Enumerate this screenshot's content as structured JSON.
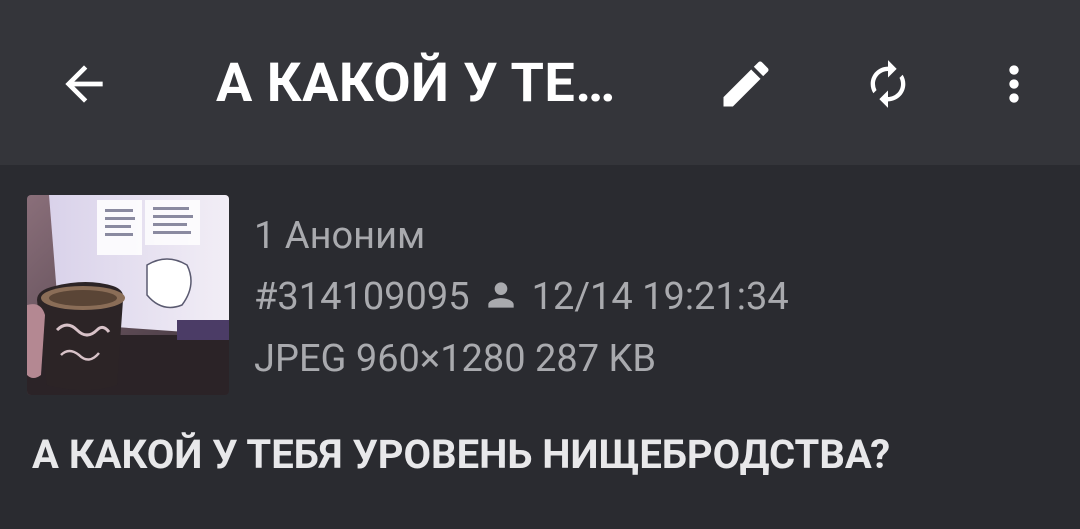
{
  "appbar": {
    "title": "А КАКОЙ У ТЕ…",
    "back_icon": "arrow-back-icon",
    "edit_icon": "pencil-icon",
    "refresh_icon": "refresh-icon",
    "more_icon": "more-vert-icon"
  },
  "post": {
    "index_name": "1 Аноним",
    "number": "#314109095",
    "datetime": "12/14 19:21:34",
    "file_info": "JPEG 960×1280 287 KB",
    "text": "А КАКОЙ У ТЕБЯ УРОВЕНЬ НИЩЕБРОДСТВА?",
    "user_icon": "person-icon"
  },
  "colors": {
    "appbar_bg": "#34353a",
    "content_bg": "#2a2b30",
    "title": "#ffffff",
    "meta": "#a9aaae",
    "post_text": "#e8e8ea"
  }
}
